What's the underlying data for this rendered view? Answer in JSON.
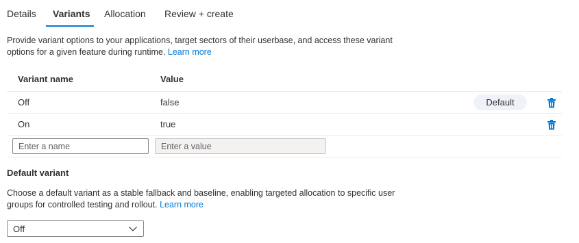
{
  "tabs": [
    {
      "label": "Details",
      "active": false
    },
    {
      "label": "Variants",
      "active": true
    },
    {
      "label": "Allocation",
      "active": false
    },
    {
      "label": "Review + create",
      "active": false
    }
  ],
  "description": {
    "text": "Provide variant options to your applications, target sectors of their userbase, and access these variant options for a given feature during runtime.",
    "link": "Learn more"
  },
  "table": {
    "headers": {
      "name": "Variant name",
      "value": "Value"
    },
    "rows": [
      {
        "name": "Off",
        "value": "false",
        "badge": "Default",
        "delete_icon": "trash-icon"
      },
      {
        "name": "On",
        "value": "true",
        "badge": "",
        "delete_icon": "trash-icon"
      }
    ],
    "new_row": {
      "name_placeholder": "Enter a name",
      "value_placeholder": "Enter a value"
    }
  },
  "default_variant": {
    "title": "Default variant",
    "description": "Choose a default variant as a stable fallback and baseline, enabling targeted allocation to specific user groups for controlled testing and rollout.",
    "link": "Learn more",
    "selected": "Off",
    "dropdown_icon": "chevron-down-icon"
  },
  "colors": {
    "accent": "#0078d4",
    "badge_bg": "#eff2f8",
    "text": "#323130"
  }
}
